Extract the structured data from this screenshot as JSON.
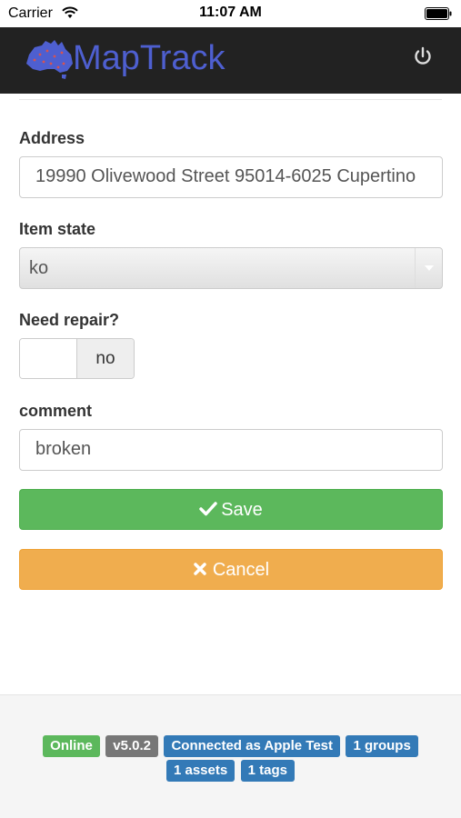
{
  "status_bar": {
    "carrier": "Carrier",
    "time": "11:07 AM"
  },
  "header": {
    "brand": "MapTrack",
    "logo_icon": "australia-map-icon",
    "power_icon": "power-icon"
  },
  "form": {
    "address_label": "Address",
    "address_value": "19990 Olivewood Street 95014-6025 Cupertino",
    "item_state_label": "Item state",
    "item_state_value": "ko",
    "need_repair_label": "Need repair?",
    "need_repair_toggle_text": "no",
    "comment_label": "comment",
    "comment_value": "broken",
    "save_label": "Save",
    "cancel_label": "Cancel"
  },
  "footer": {
    "status": "Online",
    "version": "v5.0.2",
    "connected": "Connected as Apple Test",
    "groups": "1 groups",
    "assets": "1 assets",
    "tags": "1 tags"
  },
  "colors": {
    "navbar": "#222222",
    "brand": "#4e5fd0",
    "save": "#5cb85c",
    "cancel": "#f0ad4e",
    "badge_blue": "#337ab7",
    "badge_gray": "#777777"
  }
}
